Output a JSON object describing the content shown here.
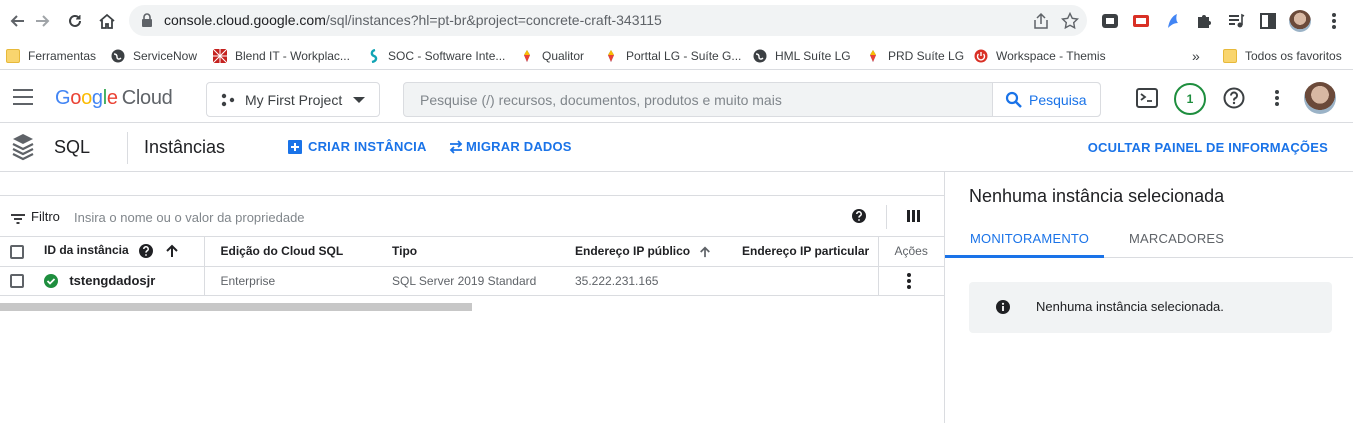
{
  "browser": {
    "url_host": "console.cloud.google.com",
    "url_path": "/sql/instances?hl=pt-br&project=concrete-craft-343115"
  },
  "bookmarks": [
    {
      "label": "Ferramentas",
      "icon": "folder-icon"
    },
    {
      "label": "ServiceNow",
      "icon": "globe-icon"
    },
    {
      "label": "Blend IT - Workplac...",
      "icon": "blend-icon"
    },
    {
      "label": "SOC - Software Inte...",
      "icon": "soc-icon"
    },
    {
      "label": "Qualitor",
      "icon": "qualitor-icon"
    },
    {
      "label": "Porttal LG - Suíte G...",
      "icon": "lg-icon"
    },
    {
      "label": "HML Suíte LG",
      "icon": "globe-icon"
    },
    {
      "label": "PRD Suíte LG",
      "icon": "lg-icon"
    },
    {
      "label": "Workspace - Themis",
      "icon": "power-icon"
    }
  ],
  "bookmarks_more": "»",
  "bookmarks_all": "Todos os favoritos",
  "gcp": {
    "logo_google": [
      "G",
      "o",
      "o",
      "g",
      "l",
      "e"
    ],
    "logo_cloud": "Cloud",
    "project": "My First Project",
    "search_placeholder": "Pesquise (/) recursos, documentos, produtos e muito mais",
    "search_button": "Pesquisa",
    "notifications": "1"
  },
  "sql_bar": {
    "product": "SQL",
    "page": "Instâncias",
    "create": "CRIAR INSTÂNCIA",
    "migrate": "MIGRAR DADOS",
    "hide_panel": "OCULTAR PAINEL DE INFORMAÇÕES"
  },
  "filter": {
    "label": "Filtro",
    "placeholder": "Insira o nome ou o valor da propriedade"
  },
  "table": {
    "columns": [
      "ID da instância",
      "Edição do Cloud SQL",
      "Tipo",
      "Endereço IP público",
      "Endereço IP particular",
      "Ações"
    ],
    "rows": [
      {
        "id": "tstengdadosjr",
        "edition": "Enterprise",
        "type": "SQL Server 2019 Standard",
        "public_ip": "35.222.231.165",
        "private_ip": "",
        "status": "running"
      }
    ]
  },
  "panel": {
    "title": "Nenhuma instância selecionada",
    "tabs": [
      "MONITORAMENTO",
      "MARCADORES"
    ],
    "notice": "Nenhuma instância selecionada."
  },
  "colors": {
    "accent": "#1a73e8",
    "status_ok": "#1e8e3e"
  }
}
